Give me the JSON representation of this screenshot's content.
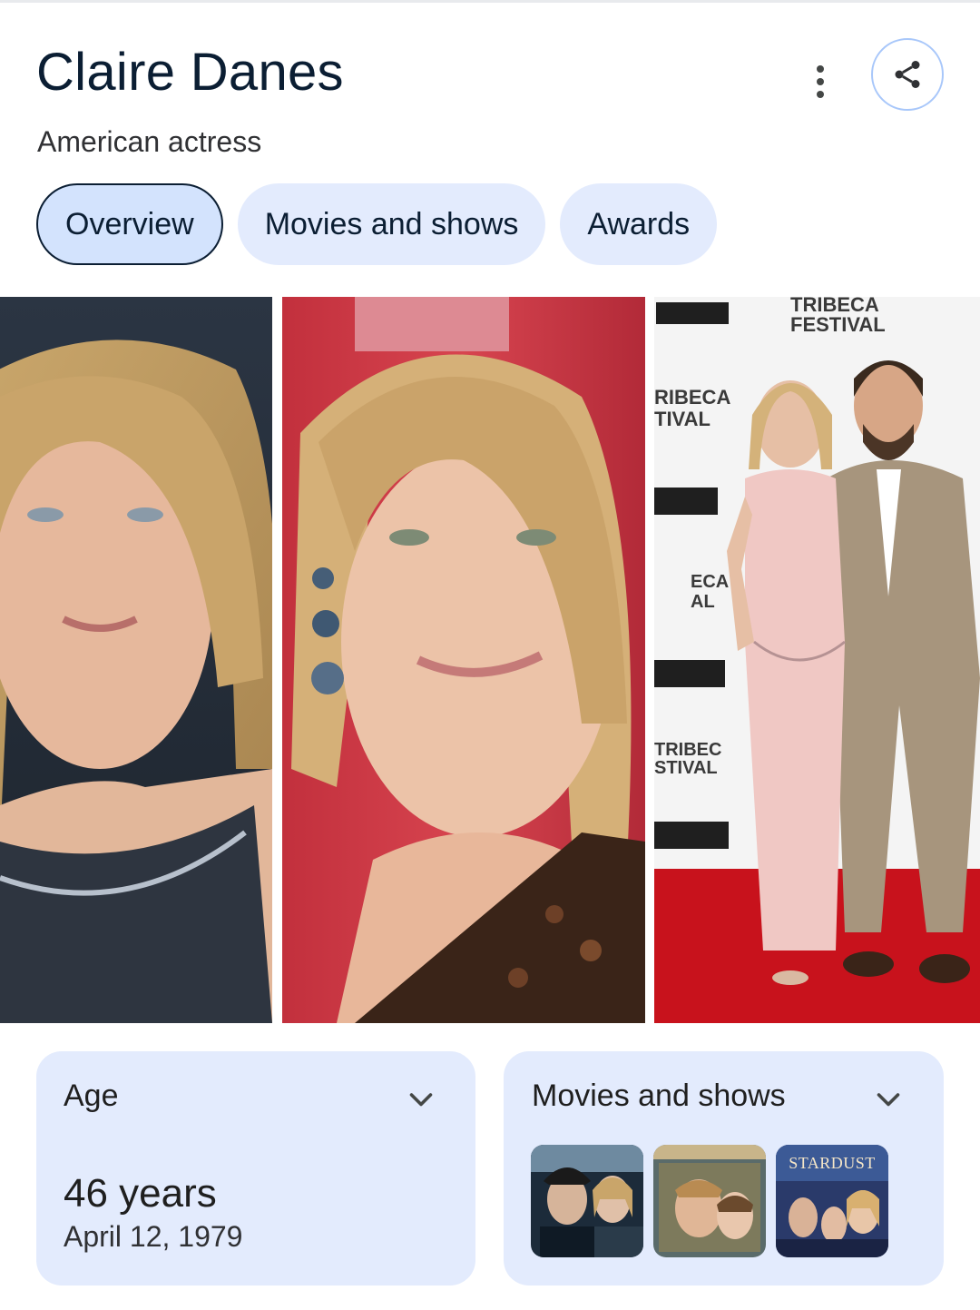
{
  "entity": {
    "name": "Claire Danes",
    "description": "American actress"
  },
  "actions": {
    "more_icon": "more-vert-icon",
    "share_icon": "share-icon"
  },
  "tabs": [
    {
      "label": "Overview",
      "active": true
    },
    {
      "label": "Movies and shows",
      "active": false
    },
    {
      "label": "Awards",
      "active": false
    }
  ],
  "images": [
    {
      "subject": "portrait-1"
    },
    {
      "subject": "portrait-2"
    },
    {
      "subject": "red-carpet-photo",
      "backdrop_text": [
        "TRIBECA",
        "FESTIVAL"
      ]
    }
  ],
  "cards": {
    "age": {
      "title": "Age",
      "value": "46 years",
      "birth_date": "April 12, 1979"
    },
    "movies": {
      "title": "Movies and shows",
      "posters": [
        {
          "name": "poster-1"
        },
        {
          "name": "poster-2"
        },
        {
          "name": "poster-3",
          "text": "STARDUST"
        }
      ]
    }
  },
  "colors": {
    "chip_bg": "#e3ebfd",
    "chip_active_bg": "#d3e3fd",
    "title_color": "#0b1e33",
    "accent_border": "#a8c7fa"
  }
}
